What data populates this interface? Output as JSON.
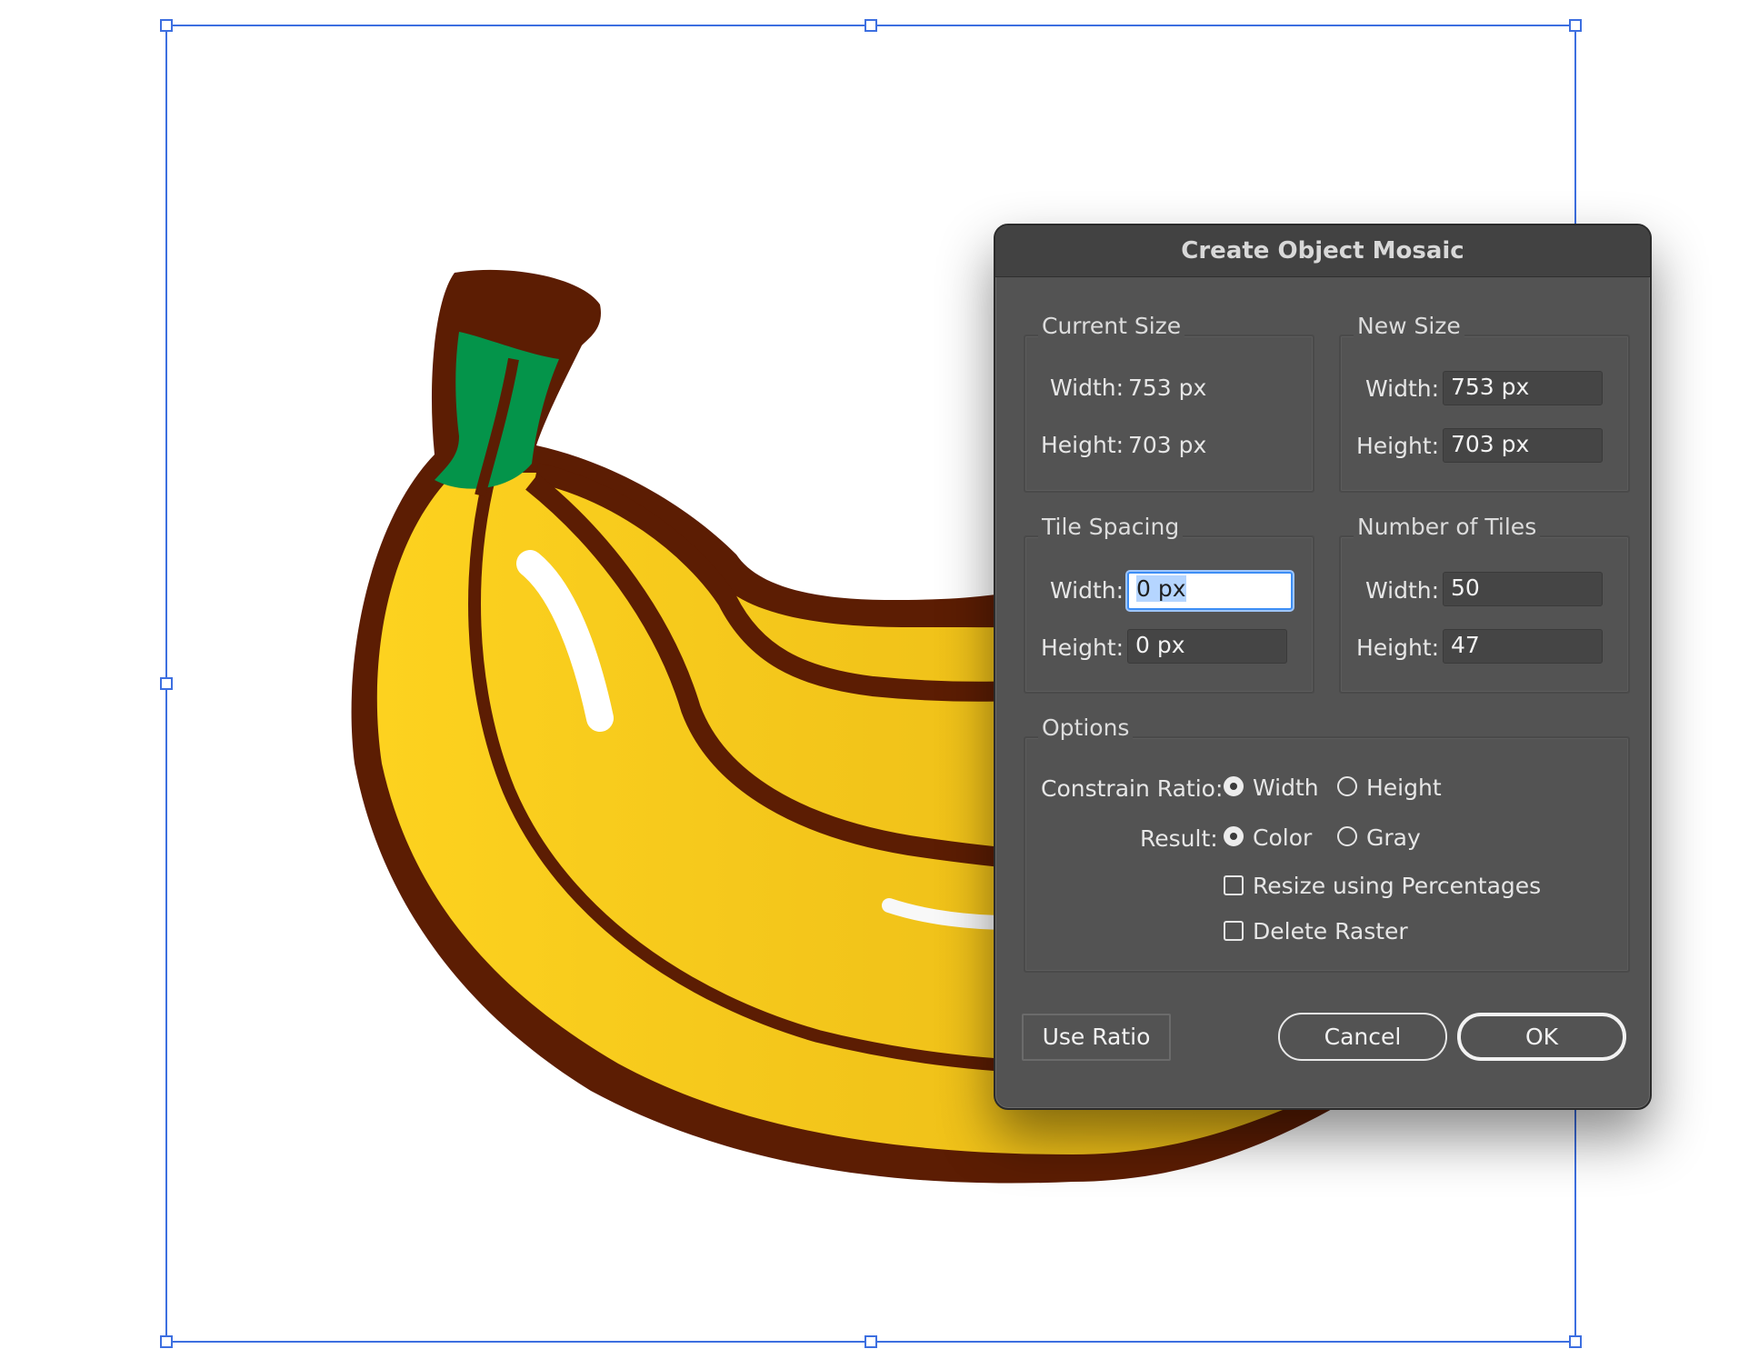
{
  "dialog": {
    "title": "Create Object Mosaic",
    "current_size": {
      "legend": "Current Size",
      "width_label": "Width:",
      "width_value": "753 px",
      "height_label": "Height:",
      "height_value": "703 px"
    },
    "new_size": {
      "legend": "New Size",
      "width_label": "Width:",
      "width_value": "753 px",
      "height_label": "Height:",
      "height_value": "703 px"
    },
    "tile_spacing": {
      "legend": "Tile Spacing",
      "width_label": "Width:",
      "width_value": "0 px",
      "height_label": "Height:",
      "height_value": "0 px"
    },
    "number_of_tiles": {
      "legend": "Number of Tiles",
      "width_label": "Width:",
      "width_value": "50",
      "height_label": "Height:",
      "height_value": "47"
    },
    "options": {
      "legend": "Options",
      "constrain_ratio_label": "Constrain Ratio:",
      "constrain_width": "Width",
      "constrain_height": "Height",
      "constrain_selected": "Width",
      "result_label": "Result:",
      "result_color": "Color",
      "result_gray": "Gray",
      "result_selected": "Color",
      "resize_percentages": "Resize using Percentages",
      "resize_percentages_checked": false,
      "delete_raster": "Delete Raster",
      "delete_raster_checked": false
    },
    "buttons": {
      "use_ratio": "Use Ratio",
      "cancel": "Cancel",
      "ok": "OK"
    }
  },
  "colors": {
    "selection_box": "#3d6fe0",
    "banana_outline": "#5c1d03",
    "banana_yellow": "#fdd21f",
    "banana_stem": "#04944a",
    "dialog_bg": "#535353",
    "focus_ring": "#3d8ef5"
  }
}
